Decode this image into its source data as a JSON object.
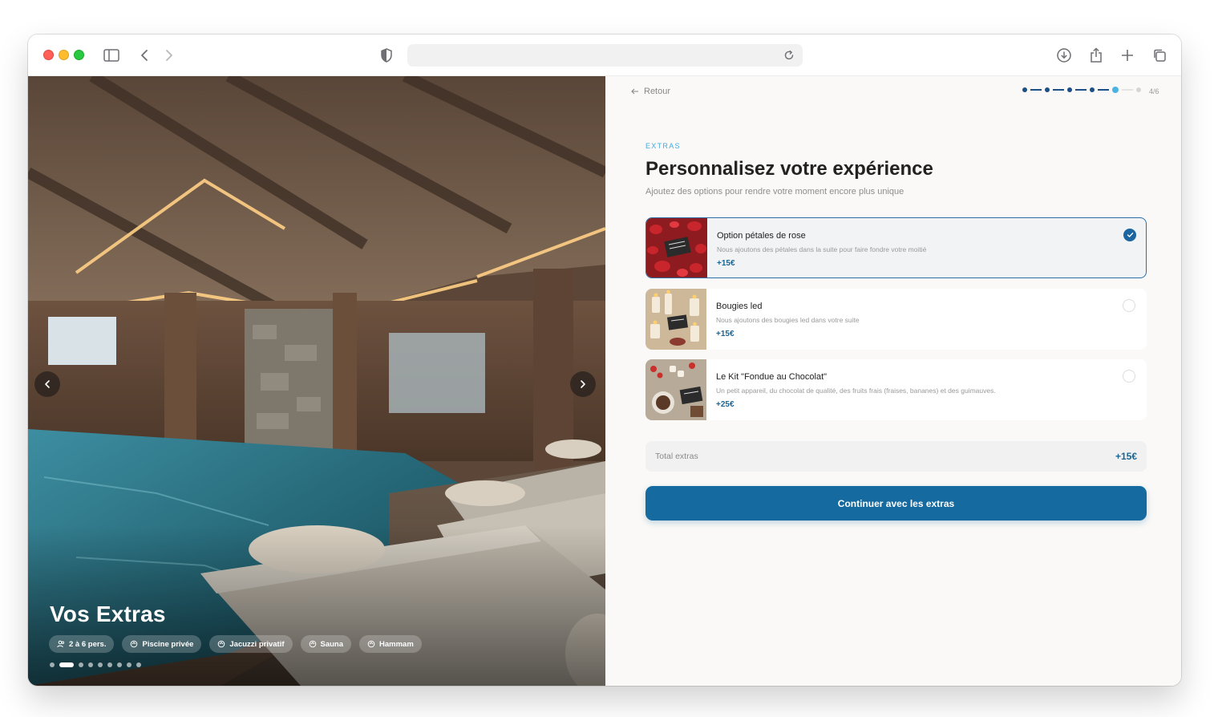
{
  "browser": {
    "url": ""
  },
  "hero": {
    "title": "Vos Extras",
    "chips": [
      {
        "icon": "people-icon",
        "label": "2 à 6 pers."
      },
      {
        "icon": "spark-icon",
        "label": "Piscine privée"
      },
      {
        "icon": "spark-icon",
        "label": "Jacuzzi privatif"
      },
      {
        "icon": "spark-icon",
        "label": "Sauna"
      },
      {
        "icon": "spark-icon",
        "label": "Hammam"
      }
    ],
    "carousel": {
      "total": 9,
      "active": 2
    }
  },
  "nav": {
    "back_label": "Retour",
    "step_label": "4/6",
    "current_step": 4,
    "total_steps": 6
  },
  "section": {
    "eyebrow": "EXTRAS",
    "title": "Personnalisez votre expérience",
    "subtitle": "Ajoutez des options pour rendre votre moment encore plus unique"
  },
  "extras": [
    {
      "title": "Option pétales de rose",
      "description": "Nous ajoutons des pétales dans la suite pour faire fondre votre moitié",
      "price": "+15€",
      "selected": true
    },
    {
      "title": "Bougies led",
      "description": "Nous ajoutons des bougies led dans votre suite",
      "price": "+15€",
      "selected": false
    },
    {
      "title": "Le Kit \"Fondue au Chocolat\"",
      "description": "Un petit appareil, du chocolat de qualité, des fruits frais (fraises, bananes) et des guimauves.",
      "price": "+25€",
      "selected": false
    }
  ],
  "total": {
    "label": "Total extras",
    "value": "+15€"
  },
  "cta": {
    "label": "Continuer avec les extras"
  },
  "colors": {
    "accent": "#156aa0",
    "eyebrow": "#47a9dc",
    "price": "#1a6593"
  }
}
